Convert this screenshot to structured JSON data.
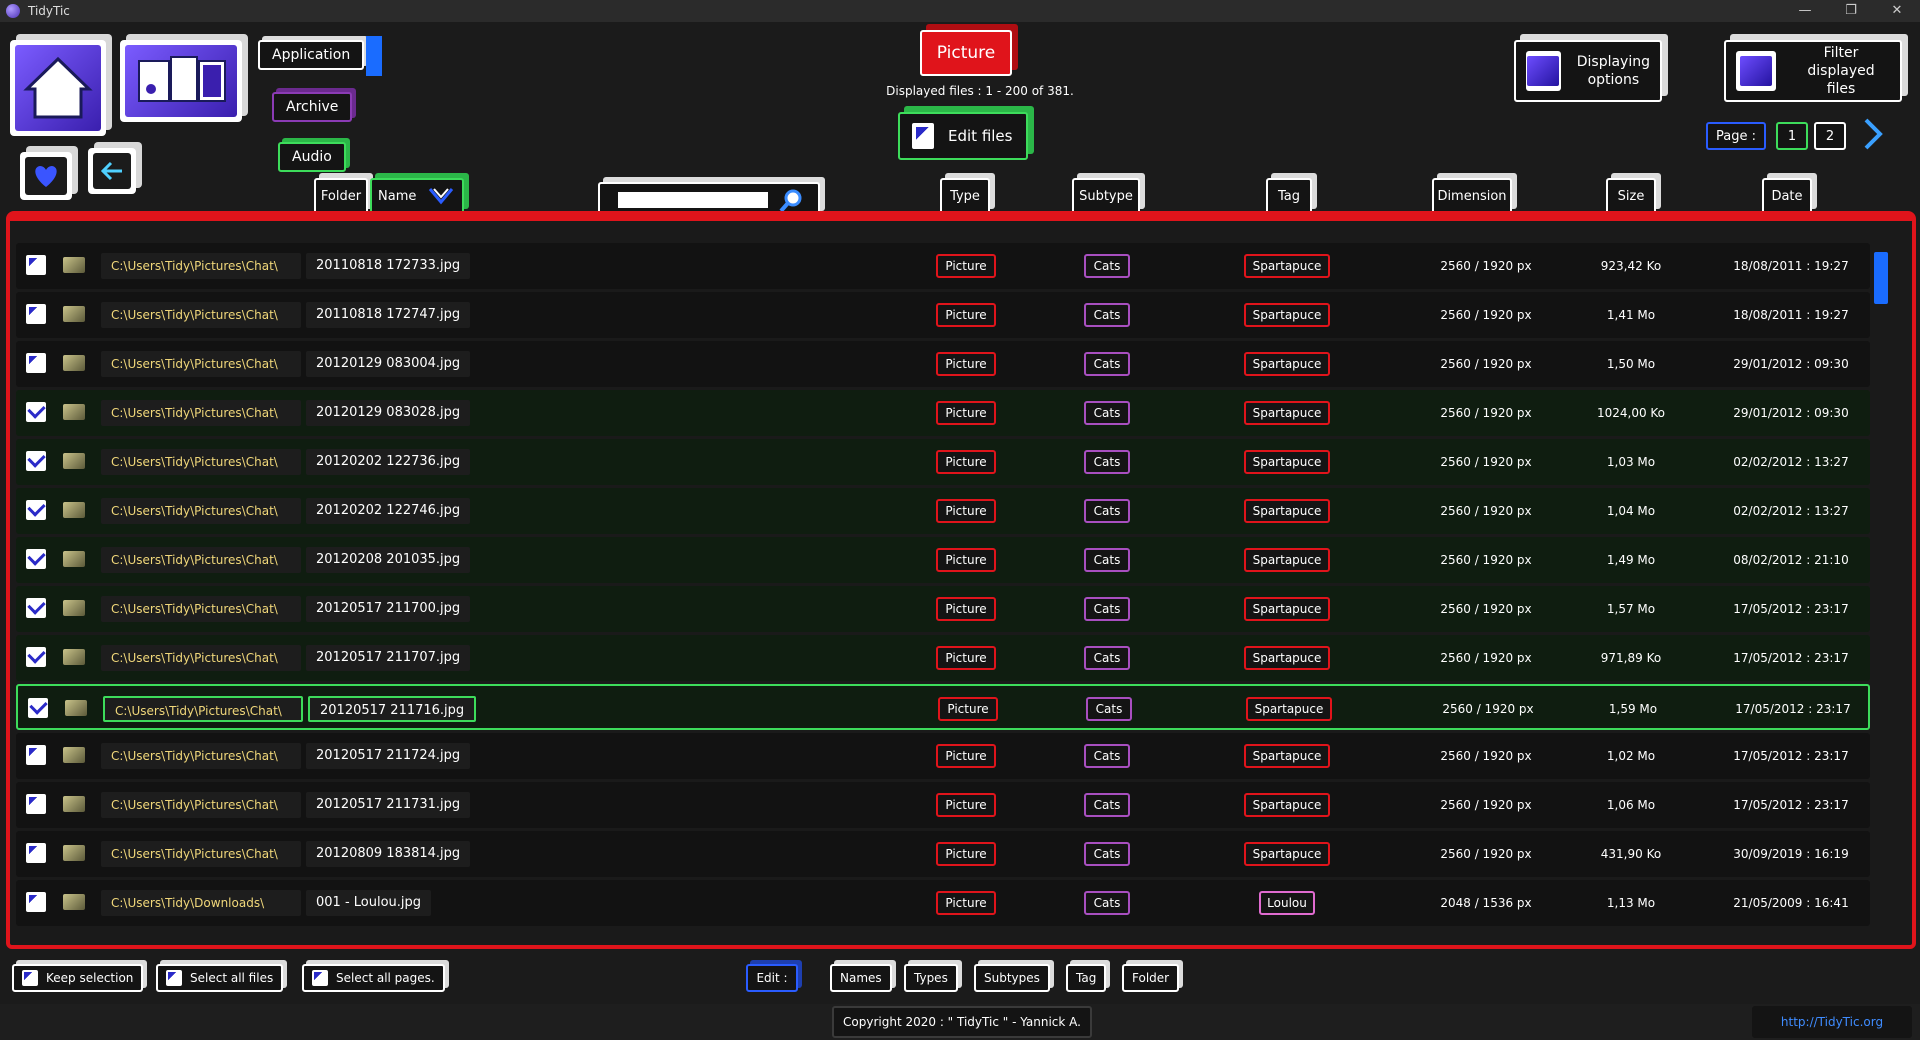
{
  "window": {
    "title": "TidyTic",
    "controls": [
      "—",
      "❐",
      "✕"
    ]
  },
  "categories": {
    "application": "Application",
    "archive": "Archive",
    "audio": "Audio"
  },
  "picture_label": "Picture",
  "displayed_info": "Displayed files : 1 - 200 of 381.",
  "edit_files_label": "Edit files",
  "displaying_options": {
    "line1": "Displaying",
    "line2": "options"
  },
  "filter_files": {
    "line1": "Filter",
    "line2": "displayed files"
  },
  "pager": {
    "label": "Page :",
    "pages": [
      "1",
      "2"
    ]
  },
  "columns": {
    "folder": "Folder",
    "name": "Name",
    "search_value": "",
    "type": "Type",
    "subtype": "Subtype",
    "tag": "Tag",
    "dimension": "Dimension",
    "size": "Size",
    "date": "Date"
  },
  "rows": [
    {
      "checked": false,
      "folder": "C:\\Users\\Tidy\\Pictures\\Chat\\",
      "name": "20110818 172733.jpg",
      "type": "Picture",
      "subtype": "Cats",
      "tag": "Spartapuce",
      "dim": "2560 / 1920 px",
      "size": "923,42 Ko",
      "date": "18/08/2011 : 19:27"
    },
    {
      "checked": false,
      "folder": "C:\\Users\\Tidy\\Pictures\\Chat\\",
      "name": "20110818 172747.jpg",
      "type": "Picture",
      "subtype": "Cats",
      "tag": "Spartapuce",
      "dim": "2560 / 1920 px",
      "size": "1,41 Mo",
      "date": "18/08/2011 : 19:27"
    },
    {
      "checked": false,
      "folder": "C:\\Users\\Tidy\\Pictures\\Chat\\",
      "name": "20120129 083004.jpg",
      "type": "Picture",
      "subtype": "Cats",
      "tag": "Spartapuce",
      "dim": "2560 / 1920 px",
      "size": "1,50 Mo",
      "date": "29/01/2012 : 09:30"
    },
    {
      "checked": true,
      "folder": "C:\\Users\\Tidy\\Pictures\\Chat\\",
      "name": "20120129 083028.jpg",
      "type": "Picture",
      "subtype": "Cats",
      "tag": "Spartapuce",
      "dim": "2560 / 1920 px",
      "size": "1024,00 Ko",
      "date": "29/01/2012 : 09:30"
    },
    {
      "checked": true,
      "folder": "C:\\Users\\Tidy\\Pictures\\Chat\\",
      "name": "20120202 122736.jpg",
      "type": "Picture",
      "subtype": "Cats",
      "tag": "Spartapuce",
      "dim": "2560 / 1920 px",
      "size": "1,03 Mo",
      "date": "02/02/2012 : 13:27"
    },
    {
      "checked": true,
      "folder": "C:\\Users\\Tidy\\Pictures\\Chat\\",
      "name": "20120202 122746.jpg",
      "type": "Picture",
      "subtype": "Cats",
      "tag": "Spartapuce",
      "dim": "2560 / 1920 px",
      "size": "1,04 Mo",
      "date": "02/02/2012 : 13:27"
    },
    {
      "checked": true,
      "folder": "C:\\Users\\Tidy\\Pictures\\Chat\\",
      "name": "20120208 201035.jpg",
      "type": "Picture",
      "subtype": "Cats",
      "tag": "Spartapuce",
      "dim": "2560 / 1920 px",
      "size": "1,49 Mo",
      "date": "08/02/2012 : 21:10"
    },
    {
      "checked": true,
      "folder": "C:\\Users\\Tidy\\Pictures\\Chat\\",
      "name": "20120517 211700.jpg",
      "type": "Picture",
      "subtype": "Cats",
      "tag": "Spartapuce",
      "dim": "2560 / 1920 px",
      "size": "1,57 Mo",
      "date": "17/05/2012 : 23:17"
    },
    {
      "checked": true,
      "folder": "C:\\Users\\Tidy\\Pictures\\Chat\\",
      "name": "20120517 211707.jpg",
      "type": "Picture",
      "subtype": "Cats",
      "tag": "Spartapuce",
      "dim": "2560 / 1920 px",
      "size": "971,89 Ko",
      "date": "17/05/2012 : 23:17"
    },
    {
      "checked": true,
      "active": true,
      "folder": "C:\\Users\\Tidy\\Pictures\\Chat\\",
      "name": "20120517 211716.jpg",
      "type": "Picture",
      "subtype": "Cats",
      "tag": "Spartapuce",
      "dim": "2560 / 1920 px",
      "size": "1,59 Mo",
      "date": "17/05/2012 : 23:17"
    },
    {
      "checked": false,
      "folder": "C:\\Users\\Tidy\\Pictures\\Chat\\",
      "name": "20120517 211724.jpg",
      "type": "Picture",
      "subtype": "Cats",
      "tag": "Spartapuce",
      "dim": "2560 / 1920 px",
      "size": "1,02 Mo",
      "date": "17/05/2012 : 23:17"
    },
    {
      "checked": false,
      "folder": "C:\\Users\\Tidy\\Pictures\\Chat\\",
      "name": "20120517 211731.jpg",
      "type": "Picture",
      "subtype": "Cats",
      "tag": "Spartapuce",
      "dim": "2560 / 1920 px",
      "size": "1,06 Mo",
      "date": "17/05/2012 : 23:17"
    },
    {
      "checked": false,
      "folder": "C:\\Users\\Tidy\\Pictures\\Chat\\",
      "name": "20120809 183814.jpg",
      "type": "Picture",
      "subtype": "Cats",
      "tag": "Spartapuce",
      "dim": "2560 / 1920 px",
      "size": "431,90 Ko",
      "date": "30/09/2019 : 16:19"
    },
    {
      "checked": false,
      "folder": "C:\\Users\\Tidy\\Downloads\\",
      "name": "001 - Loulou.jpg",
      "type": "Picture",
      "subtype": "Cats",
      "tag": "Loulou",
      "tag_style": "pink",
      "dim": "2048 / 1536 px",
      "size": "1,13 Mo",
      "date": "21/05/2009 : 16:41"
    }
  ],
  "footer": {
    "keep_selection": "Keep selection",
    "select_all_files": "Select all files",
    "select_all_pages": "Select all pages.",
    "edit": "Edit :",
    "names": "Names",
    "types": "Types",
    "subtypes": "Subtypes",
    "tag": "Tag",
    "folder": "Folder",
    "copyright": "Copyright 2020 : \" TidyTic \" - Yannick A.",
    "link": "http://TidyTic.org"
  },
  "colors": {
    "accent_red": "#e0141b",
    "accent_green": "#3ddc5b",
    "accent_blue": "#2a5cff",
    "purple": "#a84fc0"
  }
}
